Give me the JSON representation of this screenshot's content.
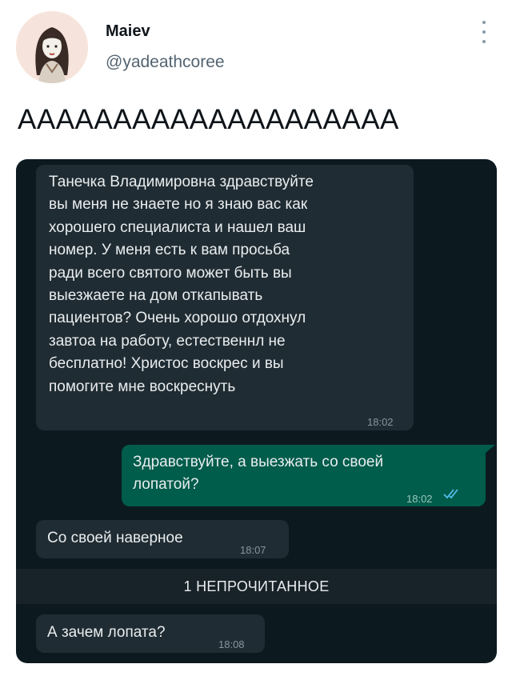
{
  "tweet": {
    "display_name": "Maiev",
    "handle": "@yadeathcoree",
    "text": "АААААААААААААААААААА",
    "avatar_icon": "user-avatar-icon",
    "more_icon": "more-vertical-icon"
  },
  "chat": {
    "messages": [
      {
        "direction": "incoming",
        "text": "Танечка Владимировна здравствуйте\nвы меня не знаете но я знаю вас как\nхорошего специалиста и нашел ваш\nномер. У меня есть к вам просьба\nради всего святого может быть вы\nвыезжаете на дом откапывать\nпациентов? Очень хорошо отдохнул\nзавтоа на работу, естественнл не\nбесплатно! Христос воскрес и вы\nпомогите мне воскреснуть",
        "time": "18:02"
      },
      {
        "direction": "outgoing",
        "text": "Здравствуйте, а выезжать со своей\nлопатой?",
        "time": "18:02",
        "status_icon": "double-check-read-icon"
      },
      {
        "direction": "incoming",
        "text": "Со своей наверное",
        "time": "18:07"
      },
      {
        "direction": "incoming",
        "text": "А зачем лопата?",
        "time": "18:08"
      }
    ],
    "unread_label": "1 НЕПРОЧИТАННОЕ"
  },
  "colors": {
    "chat_background": "#0c1a20",
    "incoming_bubble": "#202c33",
    "outgoing_bubble": "#005c4b",
    "read_ticks": "#53bdeb",
    "handle_gray": "#536471"
  }
}
